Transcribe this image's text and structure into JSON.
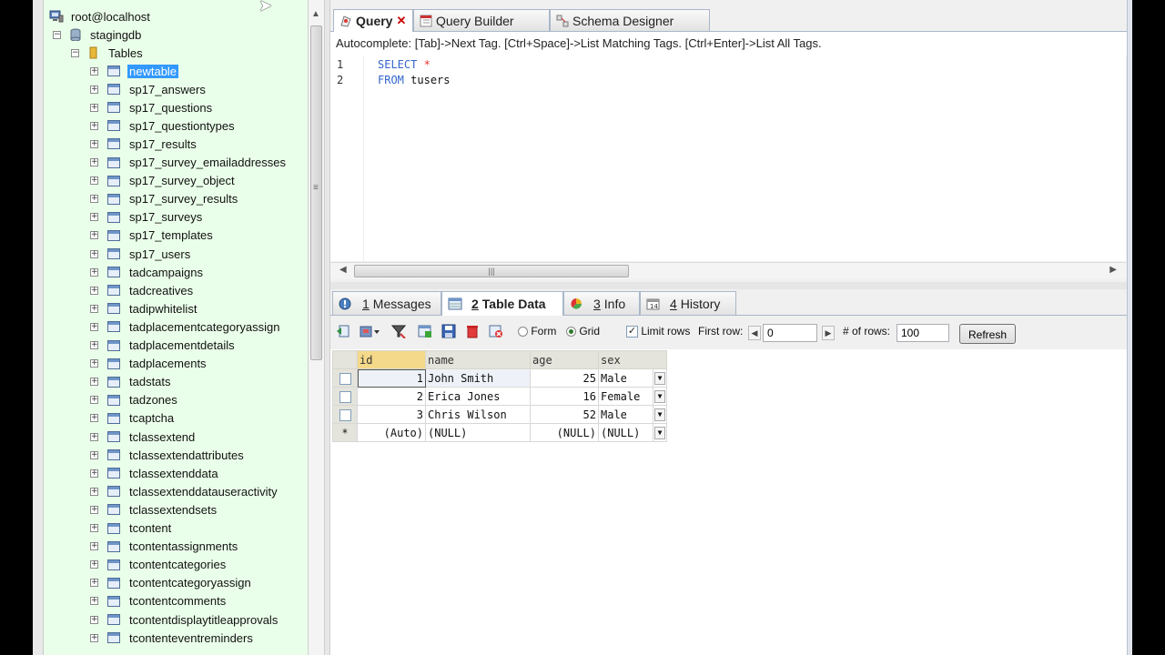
{
  "tree": {
    "connection": "root@localhost",
    "database": "stagingdb",
    "folder": "Tables",
    "tables": [
      "newtable",
      "sp17_answers",
      "sp17_questions",
      "sp17_questiontypes",
      "sp17_results",
      "sp17_survey_emailaddresses",
      "sp17_survey_object",
      "sp17_survey_results",
      "sp17_surveys",
      "sp17_templates",
      "sp17_users",
      "tadcampaigns",
      "tadcreatives",
      "tadipwhitelist",
      "tadplacementcategoryassign",
      "tadplacementdetails",
      "tadplacements",
      "tadstats",
      "tadzones",
      "tcaptcha",
      "tclassextend",
      "tclassextendattributes",
      "tclassextenddata",
      "tclassextenddatauseractivity",
      "tclassextendsets",
      "tcontent",
      "tcontentassignments",
      "tcontentcategories",
      "tcontentcategoryassign",
      "tcontentcomments",
      "tcontentdisplaytitleapprovals",
      "tcontenteventreminders"
    ],
    "selected_index": 0
  },
  "query_tabs": [
    {
      "label": "Query",
      "close": "✕",
      "icon": "query-icon"
    },
    {
      "label": "Query Builder",
      "icon": "query-builder-icon"
    },
    {
      "label": "Schema Designer",
      "icon": "schema-designer-icon"
    }
  ],
  "autocomplete_hint": "Autocomplete: [Tab]->Next Tag. [Ctrl+Space]->List Matching Tags. [Ctrl+Enter]->List All Tags.",
  "editor": {
    "lines": [
      {
        "num": "1",
        "keyword": "SELECT",
        "rest": "*"
      },
      {
        "num": "2",
        "keyword": "FROM",
        "rest": "tusers"
      }
    ]
  },
  "result_tabs": [
    {
      "num": "1",
      "label": "Messages"
    },
    {
      "num": "2",
      "label": "Table Data"
    },
    {
      "num": "3",
      "label": "Info"
    },
    {
      "num": "4",
      "label": "History"
    }
  ],
  "toolbar": {
    "form_label": "Form",
    "grid_label": "Grid",
    "limit_rows_label": "Limit rows",
    "limit_rows_checked": true,
    "first_row_label": "First row:",
    "first_row_value": "0",
    "num_rows_label": "# of rows:",
    "num_rows_value": "100",
    "refresh_label": "Refresh",
    "view_mode": "grid"
  },
  "grid": {
    "columns": [
      "id",
      "name",
      "age",
      "sex"
    ],
    "rows": [
      {
        "id": "1",
        "name": "John Smith",
        "age": "25",
        "sex": "Male"
      },
      {
        "id": "2",
        "name": "Erica Jones",
        "age": "16",
        "sex": "Female"
      },
      {
        "id": "3",
        "name": "Chris Wilson",
        "age": "52",
        "sex": "Male"
      }
    ],
    "new_row": {
      "marker": "*",
      "id": "(Auto)",
      "name": "(NULL)",
      "age": "(NULL)",
      "sex": "(NULL)"
    }
  }
}
